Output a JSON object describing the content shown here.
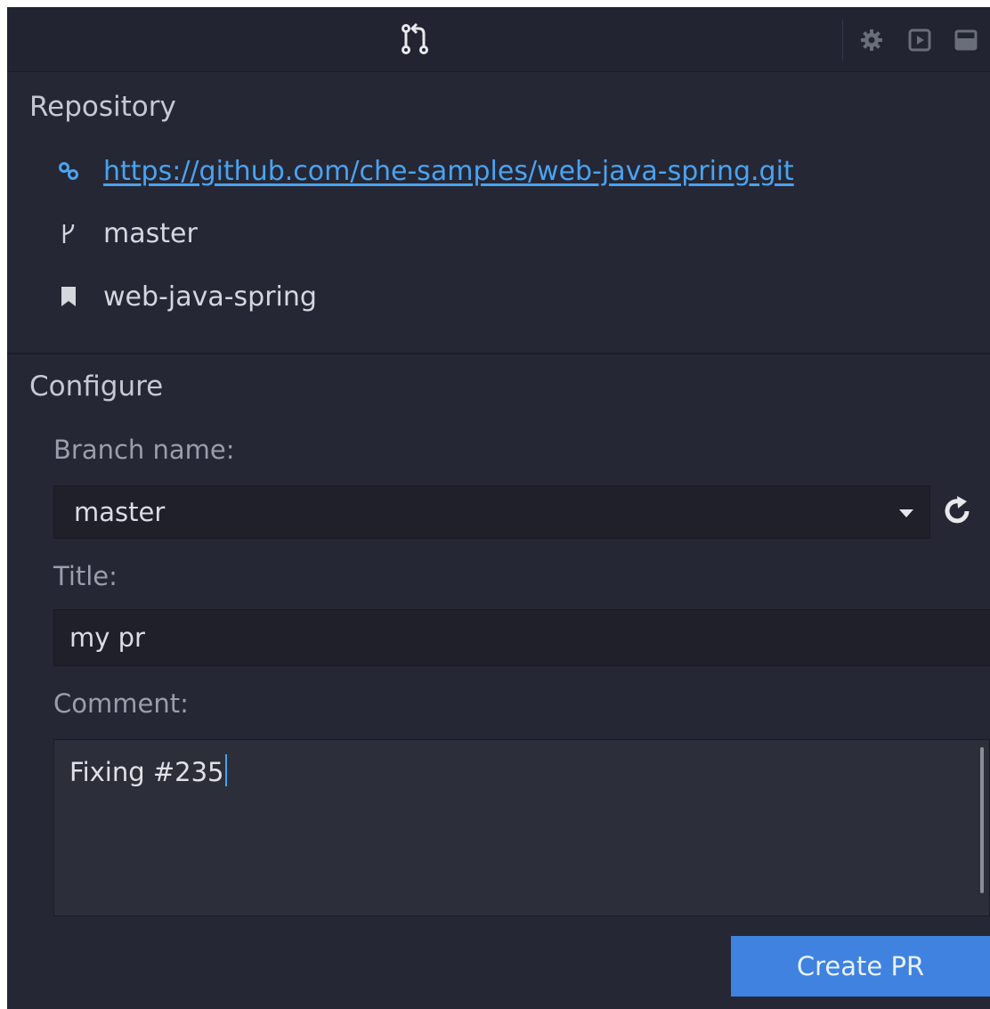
{
  "header": {
    "icons": [
      "pull-request-icon",
      "gear-icon",
      "play-icon",
      "panel-icon"
    ]
  },
  "repository": {
    "title": "Repository",
    "url": "https://github.com/che-samples/web-java-spring.git",
    "branch": "master",
    "project": "web-java-spring"
  },
  "configure": {
    "title": "Configure",
    "branch_label": "Branch name:",
    "branch_value": "master",
    "title_label": "Title:",
    "title_value": "my pr",
    "comment_label": "Comment:",
    "comment_value": "Fixing #235",
    "create_button": "Create PR"
  },
  "colors": {
    "accent": "#3f82e0",
    "link": "#4aa3f0",
    "background": "#252735"
  }
}
